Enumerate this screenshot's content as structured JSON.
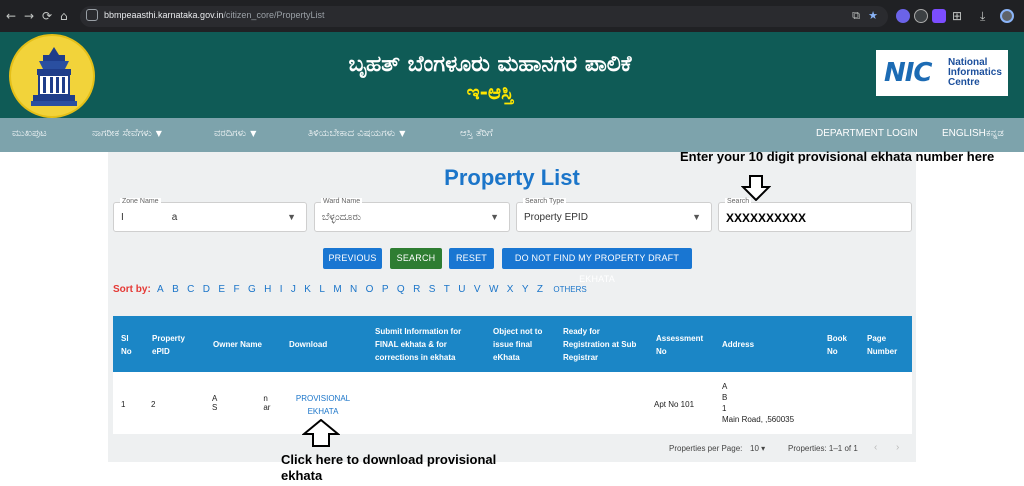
{
  "browser": {
    "url_host": "bbmpeaasthi.karnataka.gov.in",
    "url_path": "/citizen_core/PropertyList"
  },
  "header": {
    "title": "ಬೃಹತ್ ಬೆಂಗಳೂರು ಮಹಾನಗರ ಪಾಲಿಕೆ",
    "subtitle": "ಇ-ಆಸ್ತಿ",
    "nic_mark": "NIC",
    "nic_line1": "National",
    "nic_line2": "Informatics",
    "nic_line3": "Centre"
  },
  "navbar": {
    "items": [
      {
        "label": "ಮುಖಪುಟ",
        "dropdown": false
      },
      {
        "label": "ನಾಗರೀಕ ಸೇವೆಗಳು",
        "dropdown": true
      },
      {
        "label": "ವರದಿಗಳು",
        "dropdown": true
      },
      {
        "label": "ತಿಳಿಯಬೇಕಾದ ವಿಷಯಗಳು",
        "dropdown": true
      },
      {
        "label": "ಆಸ್ತಿ ತೆರಿಗೆ",
        "dropdown": false
      }
    ],
    "department_login": "DEPARTMENT LOGIN",
    "lang_en": "ENGLISH",
    "lang_kn": "ಕನ್ನಡ"
  },
  "annotations": {
    "top": "Enter your 10 digit provisional ekhata number here",
    "bottom_line1": "Click here to download provisional",
    "bottom_line2": "ekhata"
  },
  "page_title": "Property List",
  "filters": {
    "zone_label": "Zone Name",
    "zone_prefix": "I",
    "zone_suffix": "a",
    "ward_label": "Ward Name",
    "ward_value": "ಬೆಳ್ಳಂದೂರು",
    "type_label": "Search Type",
    "type_value": "Property EPID",
    "search_label": "Search",
    "search_value": "XXXXXXXXXX"
  },
  "buttons": {
    "previous": "PREVIOUS",
    "search": "SEARCH",
    "reset": "RESET",
    "not_found": "DO NOT FIND MY PROPERTY DRAFT EKHATA"
  },
  "sort": {
    "label": "Sort by:",
    "letters": [
      "A",
      "B",
      "C",
      "D",
      "E",
      "F",
      "G",
      "H",
      "I",
      "J",
      "K",
      "L",
      "M",
      "N",
      "O",
      "P",
      "Q",
      "R",
      "S",
      "T",
      "U",
      "V",
      "W",
      "X",
      "Y",
      "Z"
    ],
    "others": "OTHERS"
  },
  "table": {
    "headers": {
      "sl": [
        "Sl",
        "No"
      ],
      "epid": [
        "Property",
        "ePID"
      ],
      "owner": [
        "Owner Name"
      ],
      "download": [
        "Download"
      ],
      "submit": [
        "Submit Information for",
        "FINAL ekhata & for",
        "corrections in ekhata"
      ],
      "object": [
        "Object not to",
        "issue final",
        "eKhata"
      ],
      "ready": [
        "Ready for",
        "Registration at Sub",
        "Registrar"
      ],
      "assessment": [
        "Assessment",
        "No"
      ],
      "address": [
        "Address"
      ],
      "book": [
        "Book",
        "No"
      ],
      "page": [
        "Page",
        "Number"
      ]
    },
    "row": {
      "sl": "1",
      "epid": "2",
      "owner_l1a": "A",
      "owner_l1b": "n",
      "owner_l2a": "S",
      "owner_l2b": "ar",
      "download_l1": "PROVISIONAL",
      "download_l2": "EKHATA",
      "assessment": "Apt No 101",
      "addr_l1": "A",
      "addr_l2": "B",
      "addr_l3": "1",
      "addr_l4": "Main Road, ,560035"
    }
  },
  "pagination": {
    "per_page_label": "Properties per Page:",
    "per_page_value": "10",
    "range": "Properties: 1–1 of 1"
  }
}
